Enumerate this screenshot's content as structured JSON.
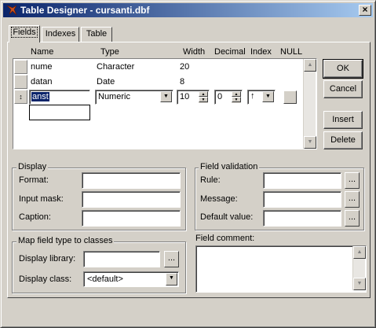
{
  "window": {
    "title": "Table Designer - cursanti.dbf",
    "close_glyph": "×"
  },
  "tabs": [
    {
      "label": "Fields",
      "active": true
    },
    {
      "label": "Indexes",
      "active": false
    },
    {
      "label": "Table",
      "active": false
    }
  ],
  "grid": {
    "columns": [
      "Name",
      "Type",
      "Width",
      "Decimal",
      "Index",
      "NULL"
    ],
    "rows": [
      {
        "name": "nume",
        "type": "Character",
        "width": "20"
      },
      {
        "name": "datan",
        "type": "Date",
        "width": "8"
      }
    ],
    "edit_row": {
      "selector_glyph": "↕",
      "name": "anst",
      "type": "Numeric",
      "width": "10",
      "decimal": "0",
      "index_glyph": "↑"
    }
  },
  "buttons": {
    "ok": "OK",
    "cancel": "Cancel",
    "insert": "Insert",
    "delete": "Delete"
  },
  "display": {
    "title": "Display",
    "format_label": "Format:",
    "input_mask_label": "Input mask:",
    "caption_label": "Caption:"
  },
  "field_validation": {
    "title": "Field validation",
    "rule_label": "Rule:",
    "message_label": "Message:",
    "default_value_label": "Default value:",
    "builder_glyph": "..."
  },
  "map_field": {
    "title": "Map field type to classes",
    "display_library_label": "Display library:",
    "display_class_label": "Display class:",
    "display_class_value": "<default>",
    "builder_glyph": "..."
  },
  "field_comment": {
    "title": "Field comment:"
  },
  "colors": {
    "title_start": "#0a246a",
    "title_end": "#a6caf0",
    "face": "#d4d0c8"
  }
}
